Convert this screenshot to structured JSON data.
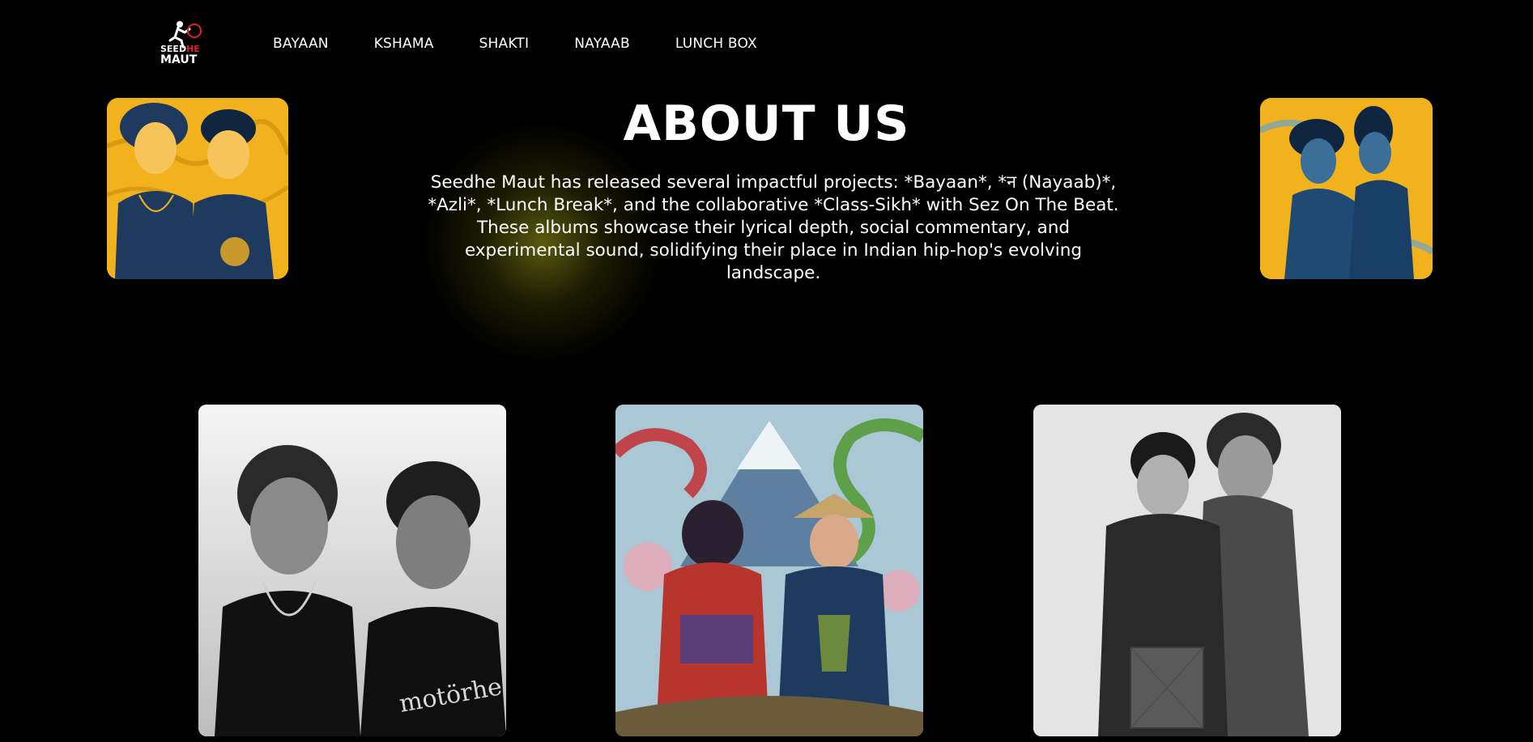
{
  "logo": {
    "line1_a": "SEED",
    "line1_b": "HE",
    "line2": "MAUT"
  },
  "nav": {
    "items": [
      {
        "label": "BAYAAN"
      },
      {
        "label": "KSHAMA"
      },
      {
        "label": "SHAKTI"
      },
      {
        "label": "NAYAAB"
      },
      {
        "label": "LUNCH BOX"
      }
    ]
  },
  "about": {
    "title": "ABOUT US",
    "description": "Seedhe Maut has released several impactful projects: *Bayaan*, *न (Nayaab)*, *Azli*, *Lunch Break*, and the collaborative *Class-Sikh* with Sez On The Beat. These albums showcase their lyrical depth, social commentary, and experimental sound, solidifying their place in Indian hip-hop's evolving landscape."
  },
  "colors": {
    "background": "#000000",
    "accent_yellow": "#f2b21e",
    "accent_navy": "#1f3a5f",
    "logo_red": "#e0202a"
  }
}
